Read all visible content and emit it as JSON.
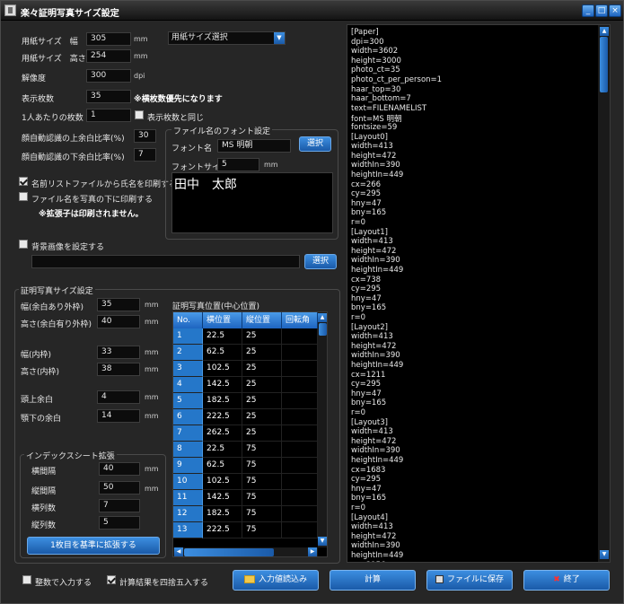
{
  "window": {
    "title": "楽々証明写真サイズ設定",
    "controls": [
      "_",
      "□",
      "×"
    ]
  },
  "paper": {
    "width_label": "用紙サイズ　幅",
    "width_value": "305",
    "width_unit": "mm",
    "height_label": "用紙サイズ　高さ",
    "height_value": "254",
    "height_unit": "mm",
    "select_value": "用紙サイズ選択",
    "dpi_label": "解像度",
    "dpi_value": "300",
    "dpi_unit": "dpi"
  },
  "counts": {
    "total_label": "表示枚数",
    "total_value": "35",
    "total_note": "※横枚数優先になります",
    "per_person_label": "1人あたりの枚数",
    "per_person_value": "1",
    "same_as_display_label": "表示枚数と同じ",
    "face_top_label": "顔自動認識の上余白比率(%)",
    "face_top_value": "30",
    "face_bottom_label": "顔自動認識の下余白比率(%)",
    "face_bottom_value": "7"
  },
  "options": {
    "print_name_label": "名前リストファイルから氏名を印刷する",
    "print_filename_label": "ファイル名を写真の下に印刷する",
    "ext_note": "※拡張子は印刷されません。",
    "bg_image_label": "背景画像を設定する",
    "bg_image_path": "",
    "bg_select_label": "選択"
  },
  "font": {
    "group_title": "ファイル名のフォント設定",
    "name_label": "フォント名",
    "name_value": "MS 明朝",
    "select_label": "選択",
    "size_label": "フォントサイズ",
    "size_value": "5",
    "size_unit": "mm",
    "preview_text": "田中　太郎"
  },
  "photo_size": {
    "group_title": "証明写真サイズ設定",
    "unit": "mm",
    "outer_width_label": "幅(余白あり外枠)",
    "outer_width_value": "35",
    "outer_height_label": "高さ(余白有り外枠)",
    "outer_height_value": "40",
    "inner_width_label": "幅(内枠)",
    "inner_width_value": "33",
    "inner_height_label": "高さ(内枠)",
    "inner_height_value": "38",
    "head_margin_label": "頭上余白",
    "head_margin_value": "4",
    "chin_margin_label": "顎下の余白",
    "chin_margin_value": "14"
  },
  "index_sheet": {
    "group_title": "インデックスシート拡張",
    "h_spacing_label": "横間隔",
    "h_spacing_value": "40",
    "v_spacing_label": "縦間隔",
    "v_spacing_value": "50",
    "cols_label": "横列数",
    "cols_value": "7",
    "rows_label": "縦列数",
    "rows_value": "5",
    "expand_button": "1枚目を基準に拡張する"
  },
  "position_table": {
    "title": "証明写真位置(中心位置)",
    "headers": [
      "No.",
      "横位置",
      "縦位置",
      "回転角"
    ],
    "rows": [
      [
        "1",
        "22.5",
        "25",
        ""
      ],
      [
        "2",
        "62.5",
        "25",
        ""
      ],
      [
        "3",
        "102.5",
        "25",
        ""
      ],
      [
        "4",
        "142.5",
        "25",
        ""
      ],
      [
        "5",
        "182.5",
        "25",
        ""
      ],
      [
        "6",
        "222.5",
        "25",
        ""
      ],
      [
        "7",
        "262.5",
        "25",
        ""
      ],
      [
        "8",
        "22.5",
        "75",
        ""
      ],
      [
        "9",
        "62.5",
        "75",
        ""
      ],
      [
        "10",
        "102.5",
        "75",
        ""
      ],
      [
        "11",
        "142.5",
        "75",
        ""
      ],
      [
        "12",
        "182.5",
        "75",
        ""
      ],
      [
        "13",
        "222.5",
        "75",
        ""
      ]
    ]
  },
  "settings_text": [
    "[Paper]",
    "dpi=300",
    "width=3602",
    "height=3000",
    "photo_ct=35",
    "photo_ct_per_person=1",
    "haar_top=30",
    "haar_bottom=7",
    "text=FILENAMELIST",
    "font=MS 明朝",
    "fontsize=59",
    "[Layout0]",
    "width=413",
    "height=472",
    "widthIn=390",
    "heightIn=449",
    "cx=266",
    "cy=295",
    "hny=47",
    "bny=165",
    "r=0",
    "[Layout1]",
    "width=413",
    "height=472",
    "widthIn=390",
    "heightIn=449",
    "cx=738",
    "cy=295",
    "hny=47",
    "bny=165",
    "r=0",
    "[Layout2]",
    "width=413",
    "height=472",
    "widthIn=390",
    "heightIn=449",
    "cx=1211",
    "cy=295",
    "hny=47",
    "bny=165",
    "r=0",
    "[Layout3]",
    "width=413",
    "height=472",
    "widthIn=390",
    "heightIn=449",
    "cx=1683",
    "cy=295",
    "hny=47",
    "bny=165",
    "r=0",
    "[Layout4]",
    "width=413",
    "height=472",
    "widthIn=390",
    "heightIn=449",
    "cx=2156",
    "cy=295",
    "hny=47",
    "bny=165",
    "r=0"
  ],
  "bottom": {
    "integer_input_label": "整数で入力する",
    "round_label": "計算結果を四捨五入する",
    "load_button": "入力値読込み",
    "calc_button": "計算",
    "save_button": "ファイルに保存",
    "exit_button": "終了"
  },
  "state": {
    "same_as_display_checked": false,
    "print_name_checked": true,
    "print_filename_checked": false,
    "bg_image_checked": false,
    "integer_input_checked": false,
    "round_checked": true
  }
}
